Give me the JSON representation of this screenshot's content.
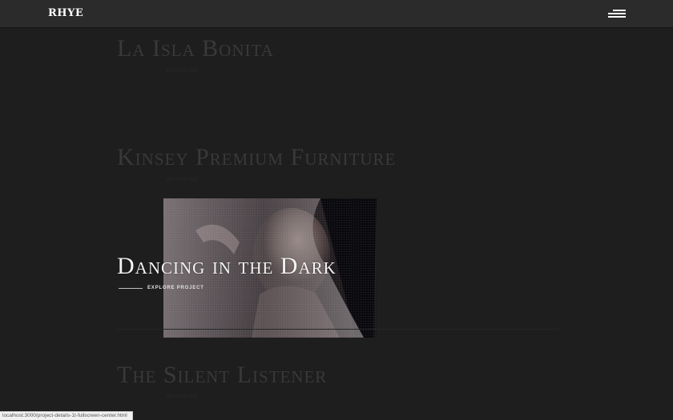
{
  "header": {
    "logo": "RHYE",
    "menu_icon": "hamburger-menu-icon"
  },
  "projects": [
    {
      "title": "La Isla Bonita",
      "subtitle": "Branding"
    },
    {
      "title": "Kinsey Premium Furniture",
      "subtitle": "Branding"
    },
    {
      "title": "Dancing in the Dark",
      "cta": "EXPLORE PROJECT"
    },
    {
      "title": "The Silent Listener",
      "subtitle": "Branding"
    }
  ],
  "status_bar": {
    "url": "localhost:3000/project-details-1t-fullscreen-center.html"
  },
  "colors": {
    "background": "#1e1e1e",
    "header": "#2b2b2b",
    "dim_title": "#393939",
    "active_title": "#f2f2f2"
  }
}
